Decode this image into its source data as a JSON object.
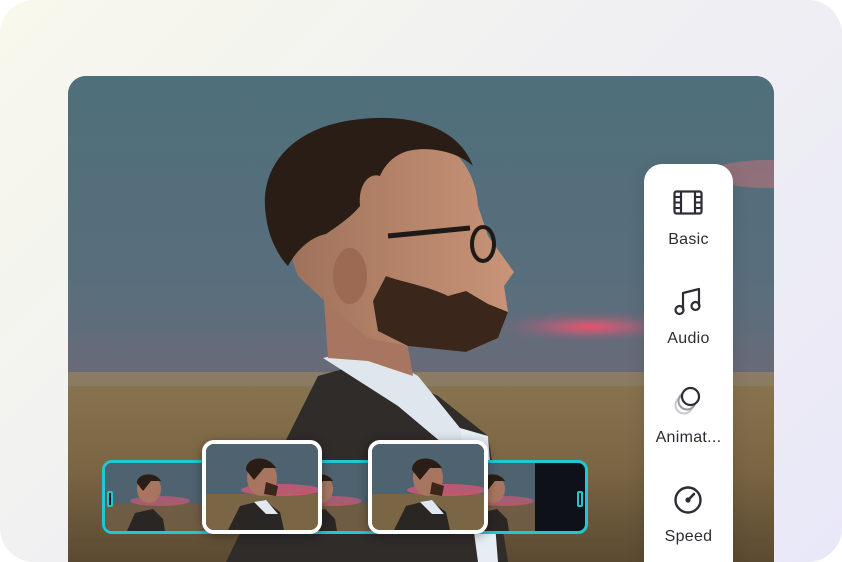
{
  "tools": [
    {
      "id": "basic",
      "label": "Basic",
      "icon": "film-icon"
    },
    {
      "id": "audio",
      "label": "Audio",
      "icon": "music-note-icon"
    },
    {
      "id": "animation",
      "label": "Animat...",
      "icon": "animation-circles-icon"
    },
    {
      "id": "speed",
      "label": "Speed",
      "icon": "speedometer-icon"
    }
  ],
  "colors": {
    "timeline_border": "#1fc8d2",
    "panel_bg": "#ffffff",
    "label_text": "#2c2c34"
  }
}
